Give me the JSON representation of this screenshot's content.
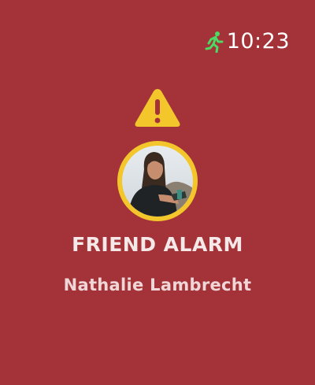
{
  "status_bar": {
    "activity_icon": "running-figure-icon",
    "activity_color": "#4cd964",
    "time": "10:23"
  },
  "alert": {
    "icon": "warning-triangle-icon",
    "icon_color": "#f3c62c",
    "title": "FRIEND ALARM",
    "friend_name": "Nathalie Lambrecht",
    "avatar_ring_color": "#f3c62c"
  },
  "background_color": "#a33338"
}
